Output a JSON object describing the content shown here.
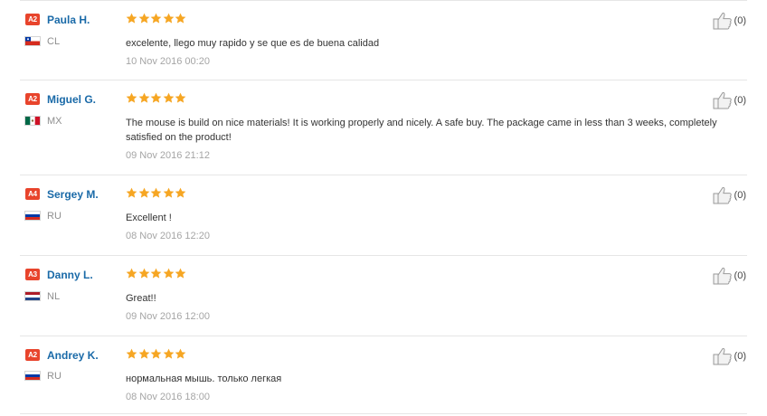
{
  "reviews": [
    {
      "level": "A2",
      "name": "Paula H.",
      "country": "CL",
      "flag": "chile",
      "rating": 5,
      "text": "excelente, llego muy rapido y se que es de buena calidad",
      "date": "10 Nov 2016 00:20",
      "helpful": "(0)"
    },
    {
      "level": "A2",
      "name": "Miguel G.",
      "country": "MX",
      "flag": "mexico",
      "rating": 5,
      "text": "The mouse is build on nice materials! It is working properly and nicely. A safe buy. The package came in less than 3 weeks, completely satisfied on the product!",
      "date": "09 Nov 2016 21:12",
      "helpful": "(0)"
    },
    {
      "level": "A4",
      "name": "Sergey M.",
      "country": "RU",
      "flag": "russia",
      "rating": 5,
      "text": "Excellent !",
      "date": "08 Nov 2016 12:20",
      "helpful": "(0)"
    },
    {
      "level": "A3",
      "name": "Danny L.",
      "country": "NL",
      "flag": "netherlands",
      "rating": 5,
      "text": "Great!!",
      "date": "09 Nov 2016 12:00",
      "helpful": "(0)"
    },
    {
      "level": "A2",
      "name": "Andrey K.",
      "country": "RU",
      "flag": "russia",
      "rating": 5,
      "text": "нормальная мышь. только легкая",
      "date": "08 Nov 2016 18:00",
      "helpful": "(0)"
    }
  ],
  "colors": {
    "badge": "#e8442c",
    "name": "#1a6aa8",
    "star": "#f6a623",
    "date": "#a5a5a5"
  },
  "icons": {
    "star": "star-icon",
    "thumb": "thumbs-up-icon"
  }
}
